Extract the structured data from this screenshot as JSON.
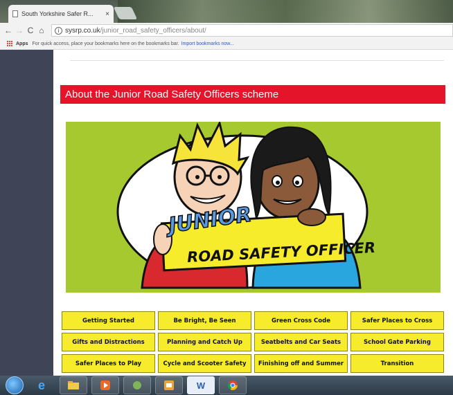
{
  "browser": {
    "tab_title": "South Yorkshire Safer R...",
    "tab_close": "×",
    "url_domain": "sysrp.co.uk",
    "url_path": "/junior_road_safety_officers/about/",
    "back_glyph": "←",
    "forward_glyph": "→",
    "reload_glyph": "C",
    "home_glyph": "⌂",
    "info_glyph": "i"
  },
  "bookmarks": {
    "apps_label": "Apps",
    "hint": "For quick access, place your bookmarks here on the bookmarks bar.",
    "import_link": "Import bookmarks now..."
  },
  "page": {
    "heading": "About the Junior Road Safety Officers scheme",
    "banner": {
      "line1": "JUNIOR",
      "line2": "ROAD SAFETY OFFICER"
    },
    "buttons": [
      "Getting Started",
      "Be Bright, Be Seen",
      "Green Cross Code",
      "Safer Places to Cross",
      "Gifts and Distractions",
      "Planning and Catch Up",
      "Seatbelts and Car Seats",
      "School Gate Parking",
      "Safer Places to Play",
      "Cycle and Scooter Safety",
      "Finishing off and Summer",
      "Transition"
    ]
  },
  "taskbar": {
    "word_label": "W",
    "ie_label": "e"
  },
  "colors": {
    "heading_red": "#e4152b",
    "banner_green": "#a6c92f",
    "button_yellow": "#f7ec2c",
    "sidebar": "#3f4456"
  }
}
